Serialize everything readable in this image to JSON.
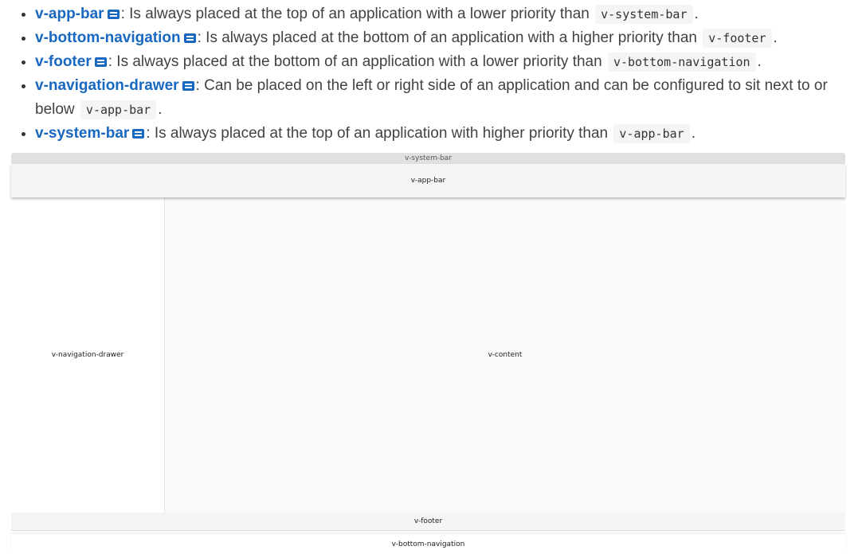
{
  "items": [
    {
      "name": "v-app-bar",
      "text": ": Is always placed at the top of an application with a lower priority than ",
      "code": "v-system-bar",
      "after": "."
    },
    {
      "name": "v-bottom-navigation",
      "text": ": Is always placed at the bottom of an application with a higher priority than ",
      "code": "v-footer",
      "after": "."
    },
    {
      "name": "v-footer",
      "text": ": Is always placed at the bottom of an application with a lower priority than ",
      "code": "v-bottom-navigation",
      "after": "."
    },
    {
      "name": "v-navigation-drawer",
      "text": ": Can be placed on the left or right side of an application and can be configured to sit next to or below ",
      "code": "v-app-bar",
      "after": "."
    },
    {
      "name": "v-system-bar",
      "text": ": Is always placed at the top of an application with higher priority than ",
      "code": "v-app-bar",
      "after": "."
    }
  ],
  "layout": {
    "system_bar": "v-system-bar",
    "app_bar": "v-app-bar",
    "drawer": "v-navigation-drawer",
    "content": "v-content",
    "footer": "v-footer",
    "bottom_nav": "v-bottom-navigation"
  },
  "colors": {
    "link": "#1867c0",
    "icon": "#1867c0"
  },
  "icon": "api-doc-icon"
}
